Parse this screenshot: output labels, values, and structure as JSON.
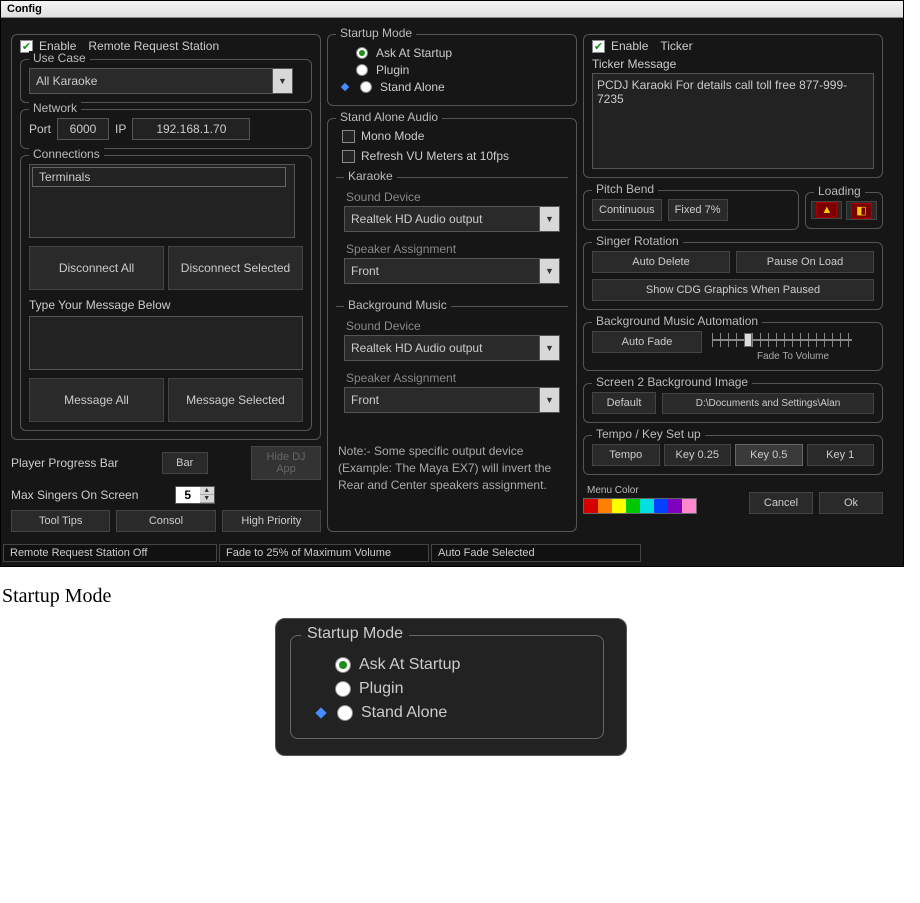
{
  "window_title": "Config",
  "remote": {
    "enable_label": "Enable",
    "title": "Remote Request Station",
    "use_case_title": "Use Case",
    "use_case_value": "All Karaoke",
    "network_title": "Network",
    "port_label": "Port",
    "port_value": "6000",
    "ip_label": "IP",
    "ip_value": "192.168.1.70",
    "connections_title": "Connections",
    "terminals_item": "Terminals",
    "disconnect_all": "Disconnect All",
    "disconnect_selected": "Disconnect Selected",
    "message_prompt": "Type Your Message Below",
    "message_all": "Message All",
    "message_selected": "Message Selected"
  },
  "player_bar": {
    "label": "Player Progress Bar",
    "bar_btn": "Bar",
    "hide_dj": "Hide DJ App",
    "max_singers_label": "Max Singers On Screen",
    "max_singers_value": "5",
    "tool_tips": "Tool Tips",
    "consol": "Consol",
    "high_priority": "High Priority"
  },
  "startup": {
    "title": "Startup Mode",
    "opt_ask": "Ask At Startup",
    "opt_plugin": "Plugin",
    "opt_standalone": "Stand Alone"
  },
  "stand_alone_audio": {
    "title": "Stand Alone Audio",
    "mono_mode": "Mono Mode",
    "refresh_vu": "Refresh VU Meters at 10fps",
    "karaoke_title": "Karaoke",
    "sound_device_label": "Sound Device",
    "sound_device_value": "Realtek HD Audio output",
    "speaker_label": "Speaker Assignment",
    "speaker_value": "Front",
    "bgm_title": "Background Music",
    "bgm_sound_device_value": "Realtek HD Audio output",
    "bgm_speaker_value": "Front",
    "note": "Note:- Some specific output device (Example: The Maya EX7) will invert the Rear and Center speakers assignment."
  },
  "ticker": {
    "enable_label": "Enable",
    "title": "Ticker",
    "msg_label": "Ticker Message",
    "msg_value": "PCDJ Karaoki  For details call toll free 877-999-7235"
  },
  "pitch_bend": {
    "title": "Pitch Bend",
    "continuous": "Continuous",
    "fixed": "Fixed 7%"
  },
  "loading": {
    "title": "Loading"
  },
  "singer_rotation": {
    "title": "Singer Rotation",
    "auto_delete": "Auto Delete",
    "pause_on_load": "Pause On Load",
    "show_cdg": "Show CDG Graphics When Paused"
  },
  "bgm_auto": {
    "title": "Background Music Automation",
    "auto_fade": "Auto Fade",
    "fade_caption": "Fade To Volume"
  },
  "screen2": {
    "title": "Screen 2 Background Image",
    "default_btn": "Default",
    "path": "D:\\Documents and Settings\\Alan"
  },
  "tempo_key": {
    "title": "Tempo / Key Set up",
    "tempo": "Tempo",
    "k025": "Key 0.25",
    "k05": "Key 0.5",
    "k1": "Key 1"
  },
  "menu_color_label": "Menu Color",
  "cancel": "Cancel",
  "ok": "Ok",
  "status": {
    "cell1": "Remote Request Station Off",
    "cell2": "Fade to 25% of Maximum Volume",
    "cell3": "Auto Fade Selected"
  },
  "section_heading": "Startup Mode",
  "menu_colors": [
    "#d40000",
    "#ff7f00",
    "#ffff00",
    "#00c800",
    "#00e0e0",
    "#0040ff",
    "#8000c0",
    "#ff88cc"
  ]
}
